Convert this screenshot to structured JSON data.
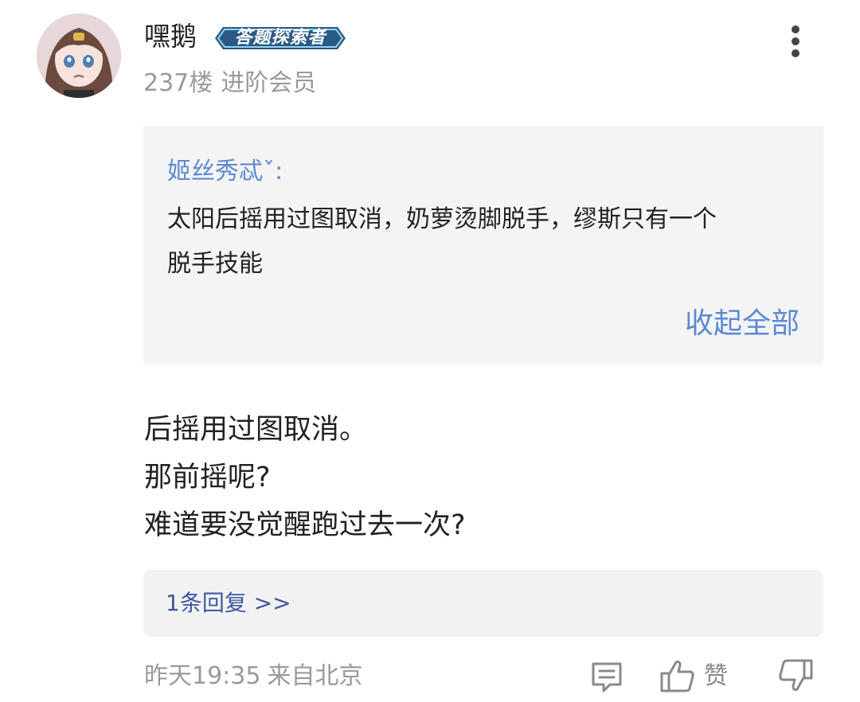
{
  "user": {
    "name": "嘿鹅",
    "badge_label": "答题探索者",
    "floor": "237楼",
    "level": "进阶会员"
  },
  "quote": {
    "author": "姬丝秀忒ˇ:",
    "text_lines": [
      "太阳后摇用过图取消，奶萝烫脚脱手，缪斯只有一个",
      "脱手技能"
    ],
    "collapse_label": "收起全部"
  },
  "body_lines": [
    "后摇用过图取消。",
    "那前摇呢?",
    "难道要没觉醒跑过去一次?"
  ],
  "replies": {
    "label": "1条回复 >>"
  },
  "footer": {
    "time": "昨天19:35",
    "location": "来自北京",
    "like_label": "赞"
  },
  "icons": {
    "more": "more-vertical-icon",
    "comment": "comment-icon",
    "like": "thumbs-up-icon",
    "dislike": "thumbs-down-icon"
  },
  "colors": {
    "link_blue": "#5b8ad3",
    "reply_blue": "#3f57a5",
    "muted_gray": "#9a9a9a",
    "quote_bg": "#f4f4f4",
    "badge_bg": "#2a5a83"
  }
}
